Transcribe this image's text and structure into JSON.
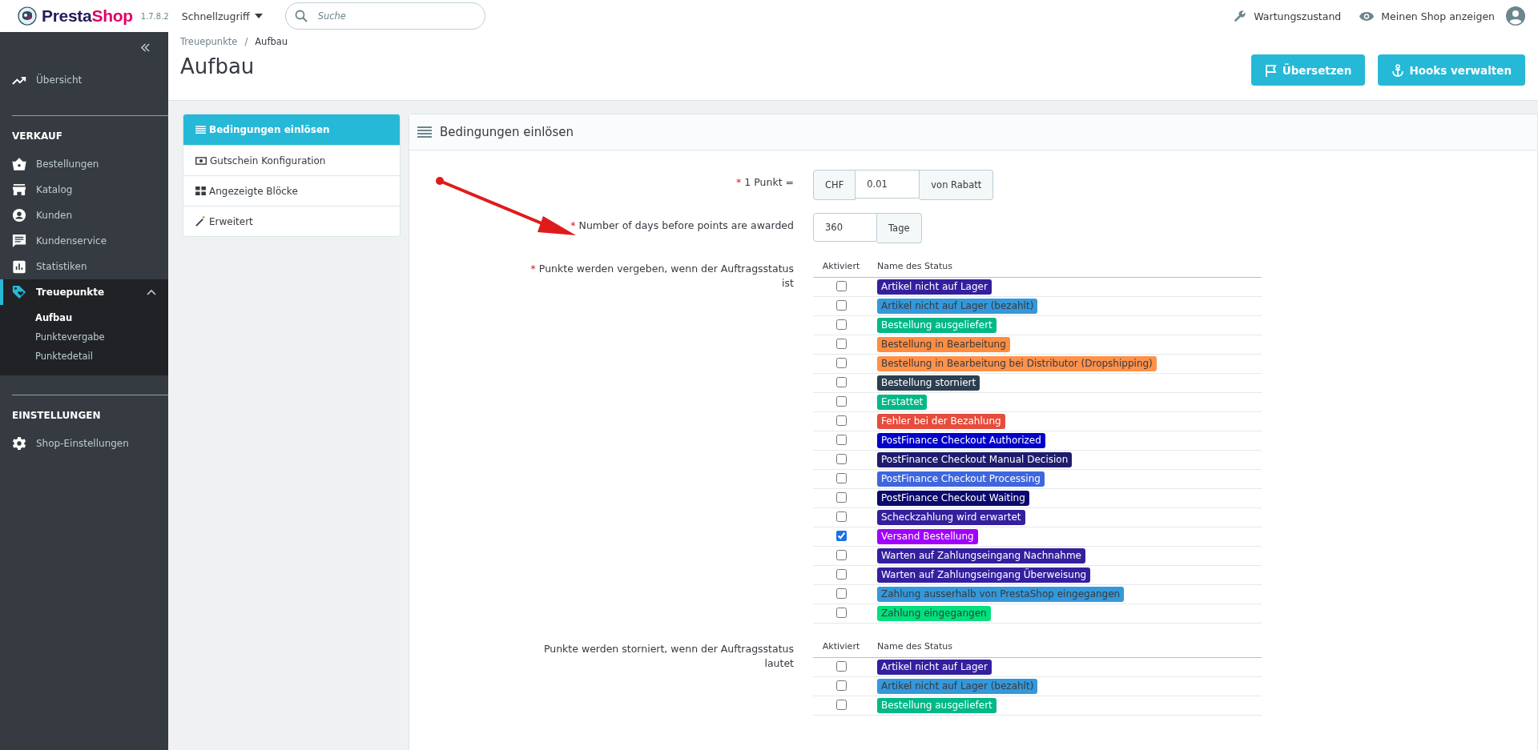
{
  "header": {
    "logo": {
      "first": "Presta",
      "second": "Shop"
    },
    "version": "1.7.8.2",
    "quick_access": "Schnellzugriff",
    "search": {
      "placeholder": "Suche"
    },
    "maintenance": "Wartungszustand",
    "view_shop": "Meinen Shop anzeigen"
  },
  "sidebar": {
    "top_items": [
      {
        "label": "Übersicht",
        "selected": false
      }
    ],
    "sections": [
      {
        "heading": "VERKAUF",
        "items": [
          {
            "label": "Bestellungen",
            "selected": false
          },
          {
            "label": "Katalog",
            "selected": false
          },
          {
            "label": "Kunden",
            "selected": false
          },
          {
            "label": "Kundenservice",
            "selected": false
          },
          {
            "label": "Statistiken",
            "selected": false
          },
          {
            "label": "Treuepunkte",
            "selected": true,
            "expanded": true,
            "children": [
              {
                "label": "Aufbau",
                "selected": true
              },
              {
                "label": "Punktevergabe",
                "selected": false
              },
              {
                "label": "Punktedetail",
                "selected": false
              }
            ]
          }
        ]
      },
      {
        "heading": "EINSTELLUNGEN",
        "items": [
          {
            "label": "Shop-Einstellungen",
            "selected": false
          }
        ]
      }
    ]
  },
  "breadcrumb": [
    "Treuepunkte",
    "Aufbau"
  ],
  "breadcrumb_separator": "/",
  "page_title": "Aufbau",
  "toolbar_buttons": [
    {
      "label": "Übersetzen"
    },
    {
      "label": "Hooks verwalten"
    }
  ],
  "config_tabs": [
    {
      "label": "Bedingungen einlösen",
      "selected": true
    },
    {
      "label": "Gutschein Konfiguration",
      "selected": false
    },
    {
      "label": "Angezeigte Blöcke",
      "selected": false
    },
    {
      "label": "Erweitert",
      "selected": false
    }
  ],
  "panel": {
    "title": "Bedingungen einlösen",
    "fields": [
      {
        "kind": "addon",
        "required_mark": "*",
        "label": "1 Punkt =",
        "prefix": "CHF",
        "value": "0.01",
        "suffix": "von Rabatt"
      },
      {
        "kind": "suffix",
        "required_mark": "*",
        "label": "Number of days before points are awarded",
        "value": "360",
        "suffix": "Tage"
      },
      {
        "kind": "status_table",
        "required_mark": "*",
        "label": "Punkte werden vergeben, wenn der Auftragsstatus ist",
        "columns": [
          "Aktiviert",
          "Name des Status"
        ],
        "rows": [
          {
            "checked": false,
            "status": "Artikel nicht auf Lager",
            "color": "#34209e"
          },
          {
            "checked": false,
            "status": "Artikel nicht auf Lager (bezahlt)",
            "color": "#3498db"
          },
          {
            "checked": false,
            "status": "Bestellung ausgeliefert",
            "color": "#01b887"
          },
          {
            "checked": false,
            "status": "Bestellung in Bearbeitung",
            "color": "#ff8c3f"
          },
          {
            "checked": false,
            "status": "Bestellung in Bearbeitung bei Distributor (Dropshipping)",
            "color": "#ff914a"
          },
          {
            "checked": false,
            "status": "Bestellung storniert",
            "color": "#2c3e50"
          },
          {
            "checked": false,
            "status": "Erstattet",
            "color": "#01b887"
          },
          {
            "checked": false,
            "status": "Fehler bei der Bezahlung",
            "color": "#e74c3c"
          },
          {
            "checked": false,
            "status": "PostFinance Checkout Authorized",
            "color": "#0000cc"
          },
          {
            "checked": false,
            "status": "PostFinance Checkout Manual Decision",
            "color": "#1f1c6e"
          },
          {
            "checked": false,
            "status": "PostFinance Checkout Processing",
            "color": "#3f66dd"
          },
          {
            "checked": false,
            "status": "PostFinance Checkout Waiting",
            "color": "#0a0a6e"
          },
          {
            "checked": false,
            "status": "Scheckzahlung wird erwartet",
            "color": "#34209e"
          },
          {
            "checked": true,
            "status": "Versand Bestellung",
            "color": "#a100ff"
          },
          {
            "checked": false,
            "status": "Warten auf Zahlungseingang Nachnahme",
            "color": "#34209e"
          },
          {
            "checked": false,
            "status": "Warten auf Zahlungseingang Überweisung",
            "color": "#34209e"
          },
          {
            "checked": false,
            "status": "Zahlung ausserhalb von PrestaShop eingegangen",
            "color": "#3498db"
          },
          {
            "checked": false,
            "status": "Zahlung eingegangen",
            "color": "#01e07c"
          }
        ]
      },
      {
        "kind": "status_table",
        "label": "Punkte werden storniert, wenn der Auftragsstatus lautet",
        "columns": [
          "Aktiviert",
          "Name des Status"
        ],
        "rows": [
          {
            "checked": false,
            "status": "Artikel nicht auf Lager",
            "color": "#34209e"
          },
          {
            "checked": false,
            "status": "Artikel nicht auf Lager (bezahlt)",
            "color": "#3498db"
          },
          {
            "checked": false,
            "status": "Bestellung ausgeliefert",
            "color": "#01b887"
          }
        ]
      }
    ]
  }
}
